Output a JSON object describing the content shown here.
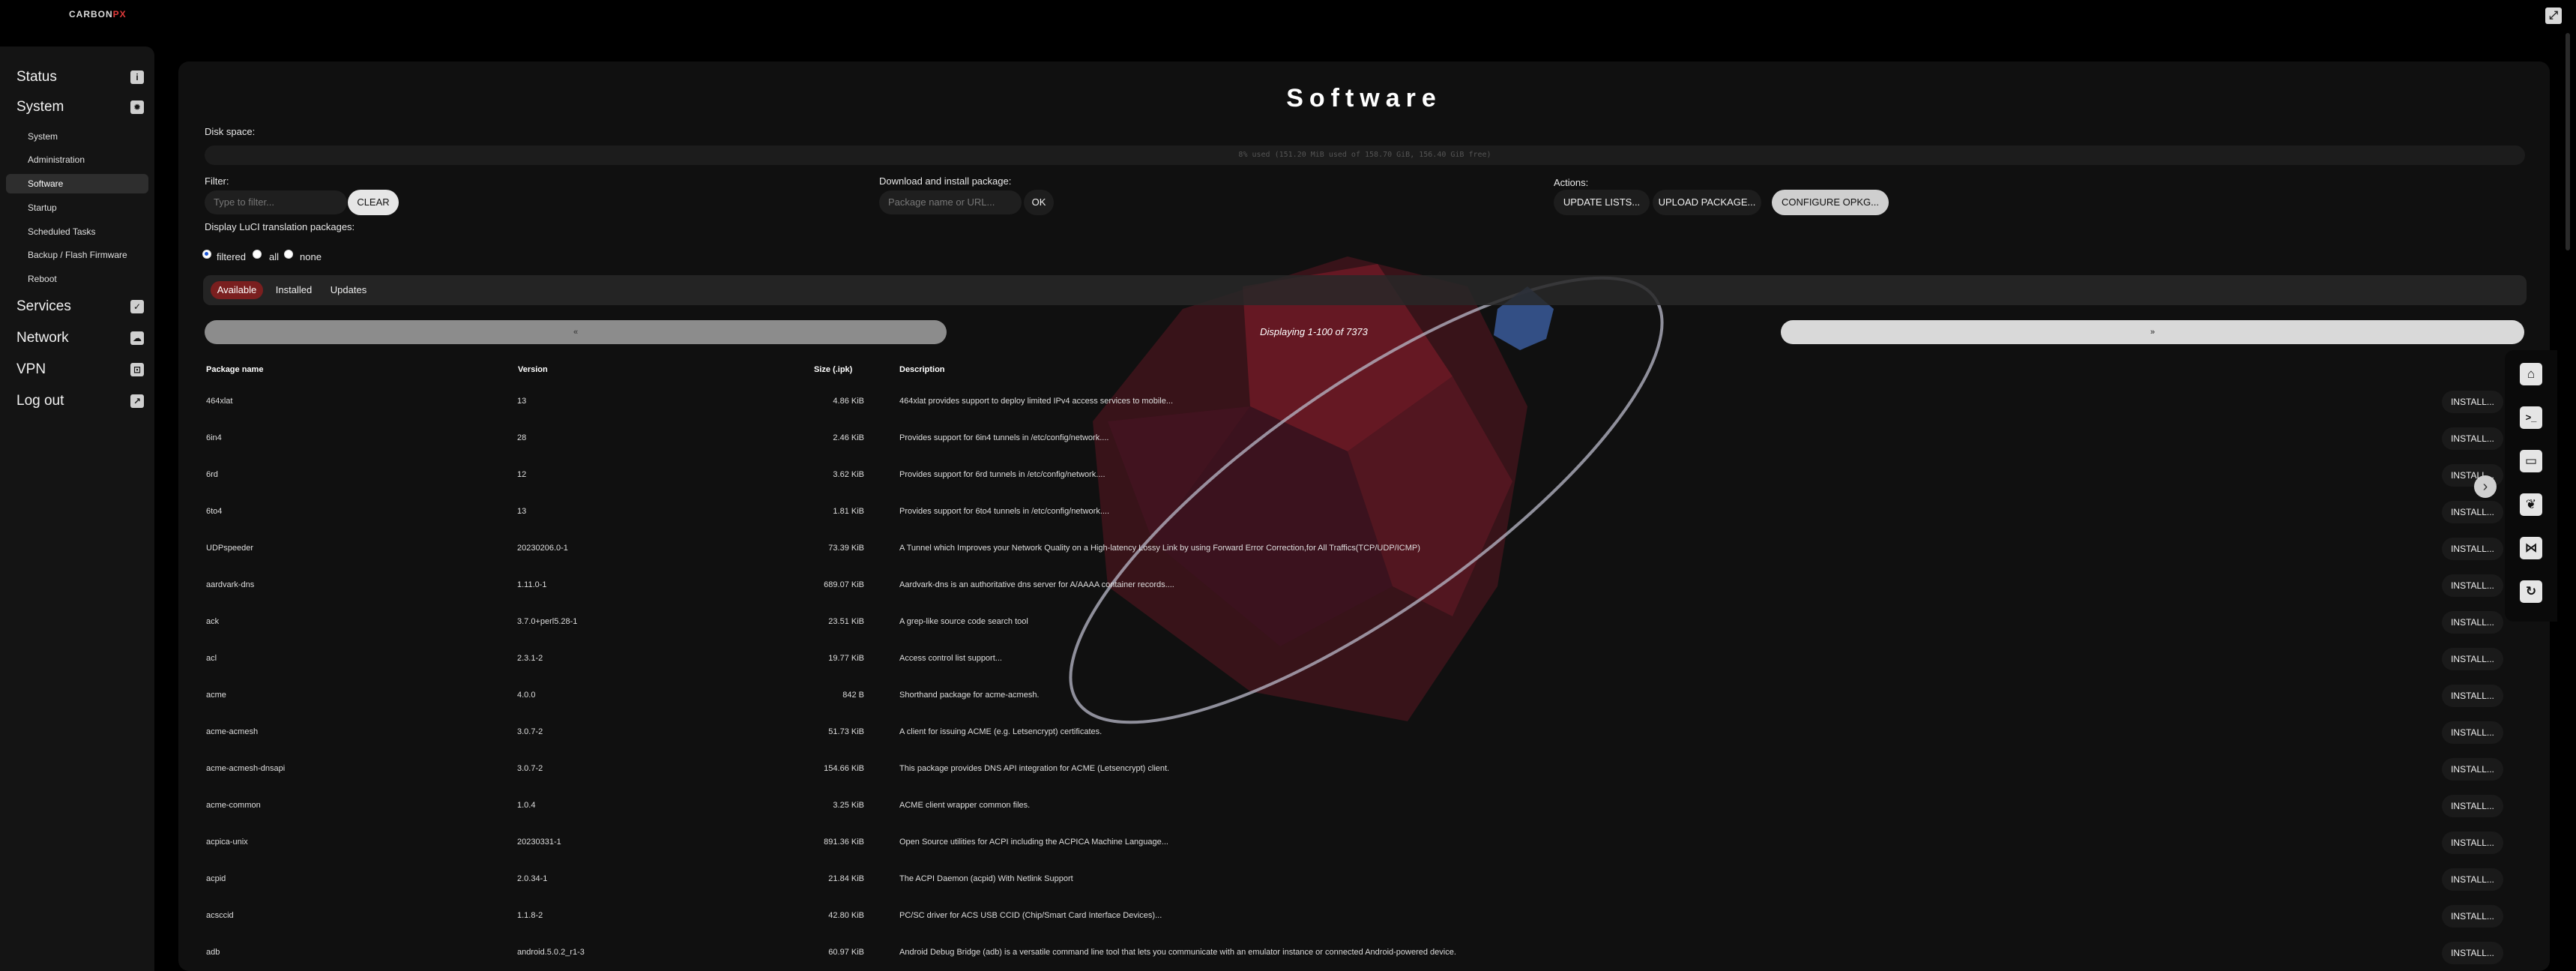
{
  "brand": {
    "text_main": "CARBON",
    "text_accent": "PX"
  },
  "sidebar": {
    "top": [
      {
        "label": "Status",
        "icon": "info-icon",
        "glyph": "i"
      },
      {
        "label": "System",
        "icon": "gear-icon",
        "glyph": "✹"
      }
    ],
    "system_items": [
      {
        "label": "System"
      },
      {
        "label": "Administration"
      },
      {
        "label": "Software",
        "active": true
      },
      {
        "label": "Startup"
      },
      {
        "label": "Scheduled Tasks"
      },
      {
        "label": "Backup / Flash Firmware"
      },
      {
        "label": "Reboot"
      }
    ],
    "bottom": [
      {
        "label": "Services",
        "icon": "checkbox-icon",
        "glyph": "✓"
      },
      {
        "label": "Network",
        "icon": "cloud-icon",
        "glyph": "☁"
      },
      {
        "label": "VPN",
        "icon": "lock-icon",
        "glyph": "⊡"
      },
      {
        "label": "Log out",
        "icon": "logout-icon",
        "glyph": "↗"
      }
    ]
  },
  "main": {
    "title": "Software",
    "disk_label": "Disk space:",
    "disk_text": "8% used (151.20 MiB used of 158.70 GiB, 156.40 GiB free)",
    "filter_label": "Filter:",
    "filter_placeholder": "Type to filter...",
    "clear_label": "CLEAR",
    "download_label": "Download and install package:",
    "download_placeholder": "Package name or URL...",
    "ok_label": "OK",
    "actions_label": "Actions:",
    "update_label": "UPDATE LISTS...",
    "upload_label": "UPLOAD PACKAGE...",
    "configure_label": "CONFIGURE OPKG...",
    "translation_label": "Display LuCI translation packages:",
    "radio": {
      "filtered": "filtered",
      "all": "all",
      "none": "none",
      "selected": "filtered"
    },
    "tabs": {
      "available": "Available",
      "installed": "Installed",
      "updates": "Updates"
    },
    "pager": {
      "prev": "«",
      "next": "»",
      "info": "Displaying 1-100 of 7373"
    },
    "columns": {
      "name": "Package name",
      "version": "Version",
      "size": "Size (.ipk)",
      "description": "Description"
    },
    "install_label": "INSTALL...",
    "packages": [
      {
        "name": "464xlat",
        "version": "13",
        "size": "4.86 KiB",
        "desc": "464xlat provides support to deploy limited IPv4 access services to mobile..."
      },
      {
        "name": "6in4",
        "version": "28",
        "size": "2.46 KiB",
        "desc": "Provides support for 6in4 tunnels in /etc/config/network...."
      },
      {
        "name": "6rd",
        "version": "12",
        "size": "3.62 KiB",
        "desc": "Provides support for 6rd tunnels in /etc/config/network...."
      },
      {
        "name": "6to4",
        "version": "13",
        "size": "1.81 KiB",
        "desc": "Provides support for 6to4 tunnels in /etc/config/network...."
      },
      {
        "name": "UDPspeeder",
        "version": "20230206.0-1",
        "size": "73.39 KiB",
        "desc": "A Tunnel which Improves your Network Quality on a High-latency Lossy Link by using Forward Error Correction,for All Traffics(TCP/UDP/ICMP)"
      },
      {
        "name": "aardvark-dns",
        "version": "1.11.0-1",
        "size": "689.07 KiB",
        "desc": "Aardvark-dns is an authoritative dns server for A/AAAA container records...."
      },
      {
        "name": "ack",
        "version": "3.7.0+perl5.28-1",
        "size": "23.51 KiB",
        "desc": "A grep-like source code search tool"
      },
      {
        "name": "acl",
        "version": "2.3.1-2",
        "size": "19.77 KiB",
        "desc": "Access control list support..."
      },
      {
        "name": "acme",
        "version": "4.0.0",
        "size": "842 B",
        "desc": "Shorthand package for acme-acmesh."
      },
      {
        "name": "acme-acmesh",
        "version": "3.0.7-2",
        "size": "51.73 KiB",
        "desc": "A client for issuing ACME (e.g. Letsencrypt) certificates."
      },
      {
        "name": "acme-acmesh-dnsapi",
        "version": "3.0.7-2",
        "size": "154.66 KiB",
        "desc": "This package provides DNS API integration for ACME (Letsencrypt) client."
      },
      {
        "name": "acme-common",
        "version": "1.0.4",
        "size": "3.25 KiB",
        "desc": "ACME client wrapper common files."
      },
      {
        "name": "acpica-unix",
        "version": "20230331-1",
        "size": "891.36 KiB",
        "desc": "Open Source utilities for ACPI including the ACPICA Machine Language..."
      },
      {
        "name": "acpid",
        "version": "2.0.34-1",
        "size": "21.84 KiB",
        "desc": "The ACPI Daemon (acpid) With Netlink Support"
      },
      {
        "name": "acsccid",
        "version": "1.1.8-2",
        "size": "42.80 KiB",
        "desc": "PC/SC driver for ACS USB CCID (Chip/Smart Card Interface Devices)..."
      },
      {
        "name": "adb",
        "version": "android.5.0.2_r1-3",
        "size": "60.97 KiB",
        "desc": "Android Debug Bridge (adb) is a versatile command line tool that lets you communicate with an emulator instance or connected Android-powered device."
      }
    ]
  },
  "right_toolbar": [
    {
      "icon": "home-icon",
      "glyph": "⌂"
    },
    {
      "icon": "terminal-icon",
      "glyph": ">_"
    },
    {
      "icon": "storage-icon",
      "glyph": "▭"
    },
    {
      "icon": "leaf-icon",
      "glyph": "❦"
    },
    {
      "icon": "share-icon",
      "glyph": "⋈"
    },
    {
      "icon": "refresh-icon",
      "glyph": "↻"
    }
  ],
  "expand_glyph": "⤢",
  "next_arrow_glyph": "›"
}
